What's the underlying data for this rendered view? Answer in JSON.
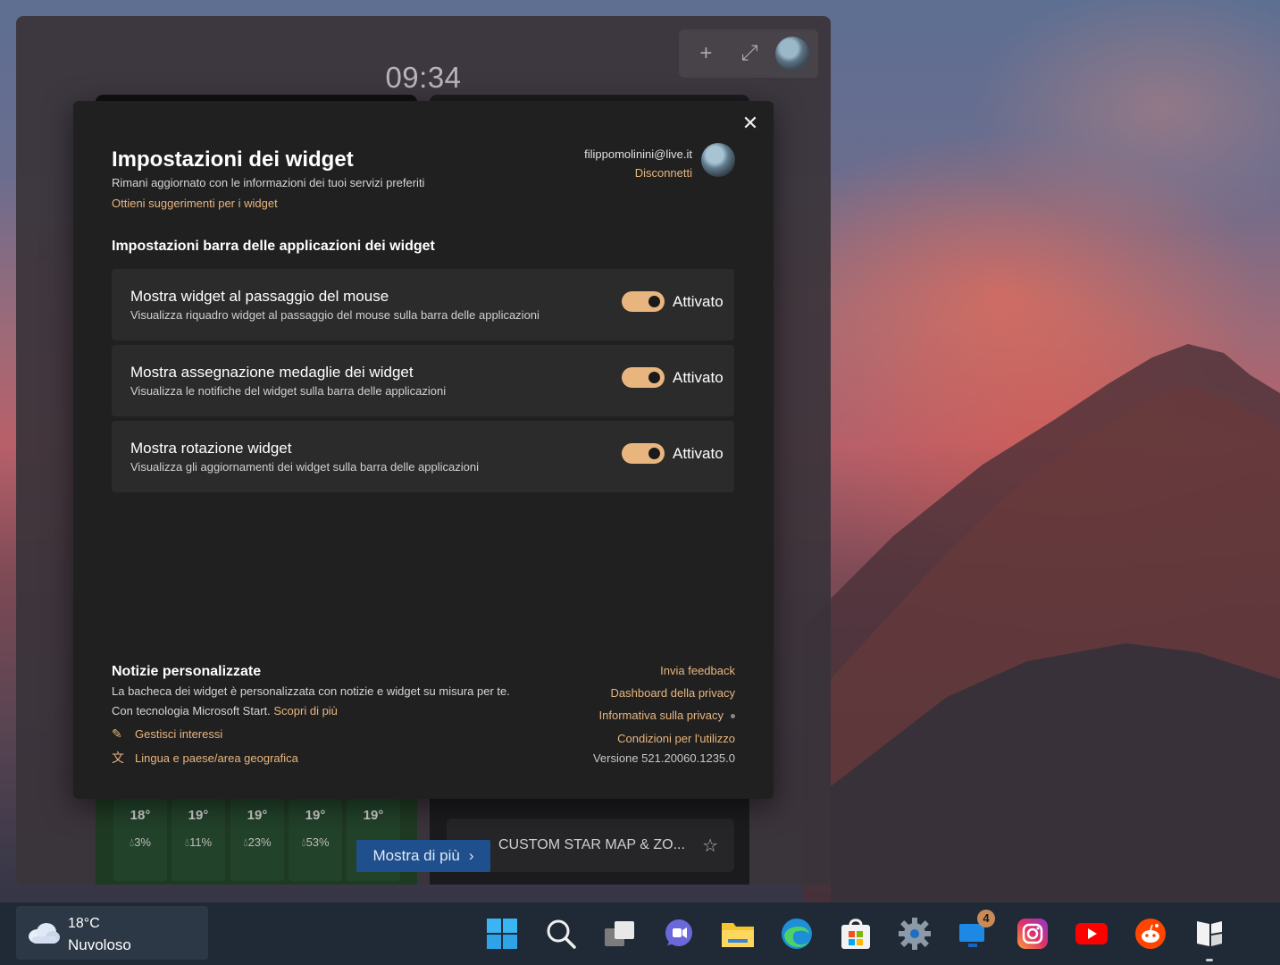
{
  "board": {
    "time": "09:34",
    "tools": {
      "add_icon": "plus-icon",
      "expand_icon": "expand-icon"
    }
  },
  "weather_forecast": [
    {
      "temp": "18°",
      "rain": "3%"
    },
    {
      "temp": "19°",
      "rain": "11%"
    },
    {
      "temp": "19°",
      "rain": "23%"
    },
    {
      "temp": "19°",
      "rain": "53%"
    },
    {
      "temp": "19°",
      "rain": ""
    }
  ],
  "news_card": {
    "title": "CUSTOM STAR MAP & ZO..."
  },
  "more_button": {
    "label": "Mostra di più"
  },
  "dialog": {
    "title": "Impostazioni dei widget",
    "subtitle": "Rimani aggiornato con le informazioni dei tuoi servizi preferiti",
    "suggestions_link": "Ottieni suggerimenti per i widget",
    "account": {
      "email": "filippomolinini@live.it",
      "disconnect": "Disconnetti"
    },
    "section_title": "Impostazioni barra delle applicazioni dei widget",
    "settings": [
      {
        "name": "Mostra widget al passaggio del mouse",
        "description": "Visualizza riquadro widget al passaggio del mouse sulla barra delle applicazioni",
        "state": "Attivato"
      },
      {
        "name": "Mostra assegnazione medaglie dei widget",
        "description": "Visualizza le notifiche del widget sulla barra delle applicazioni",
        "state": "Attivato"
      },
      {
        "name": "Mostra rotazione widget",
        "description": "Visualizza gli aggiornamenti dei widget sulla barra delle applicazioni",
        "state": "Attivato"
      }
    ],
    "news": {
      "title": "Notizie personalizzate",
      "description": "La bacheca dei widget è personalizzata con notizie e widget su misura per te.",
      "powered_by": "Con tecnologia Microsoft Start.",
      "learn_more": "Scopri di più",
      "manage_interests": "Gestisci interessi",
      "language_region": "Lingua e paese/area geografica"
    },
    "links": {
      "feedback": "Invia feedback",
      "privacy_dashboard": "Dashboard della privacy",
      "privacy_statement": "Informativa sulla privacy",
      "terms": "Condizioni per l'utilizzo"
    },
    "version": "Versione 521.20060.1235.0"
  },
  "taskbar": {
    "weather_temp": "18°C",
    "weather_condition": "Nuvoloso",
    "notification_badge": "4",
    "icons": [
      "start-icon",
      "search-icon",
      "task-view-icon",
      "teams-chat-icon",
      "file-explorer-icon",
      "edge-icon",
      "store-icon",
      "settings-icon",
      "remote-desktop-icon",
      "instagram-icon",
      "youtube-icon",
      "reddit-icon",
      "widgets-icon"
    ]
  }
}
